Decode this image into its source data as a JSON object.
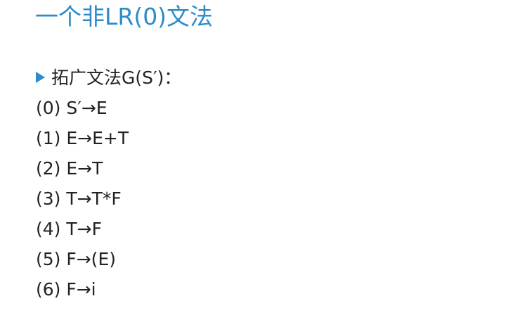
{
  "slide": {
    "title": "一个非LR(0)文法",
    "bullet": "拓广文法G(S′)：",
    "rules": [
      "(0) S′→E",
      "(1) E→E+T",
      "(2) E→T",
      "(3) T→T*F",
      "(4) T→F",
      "(5) F→(E)",
      "(6) F→i"
    ]
  },
  "colors": {
    "accent": "#2e8bc9",
    "text": "#222222",
    "background": "#ffffff"
  },
  "icons": {
    "bullet": "triangle-bullet-icon"
  }
}
